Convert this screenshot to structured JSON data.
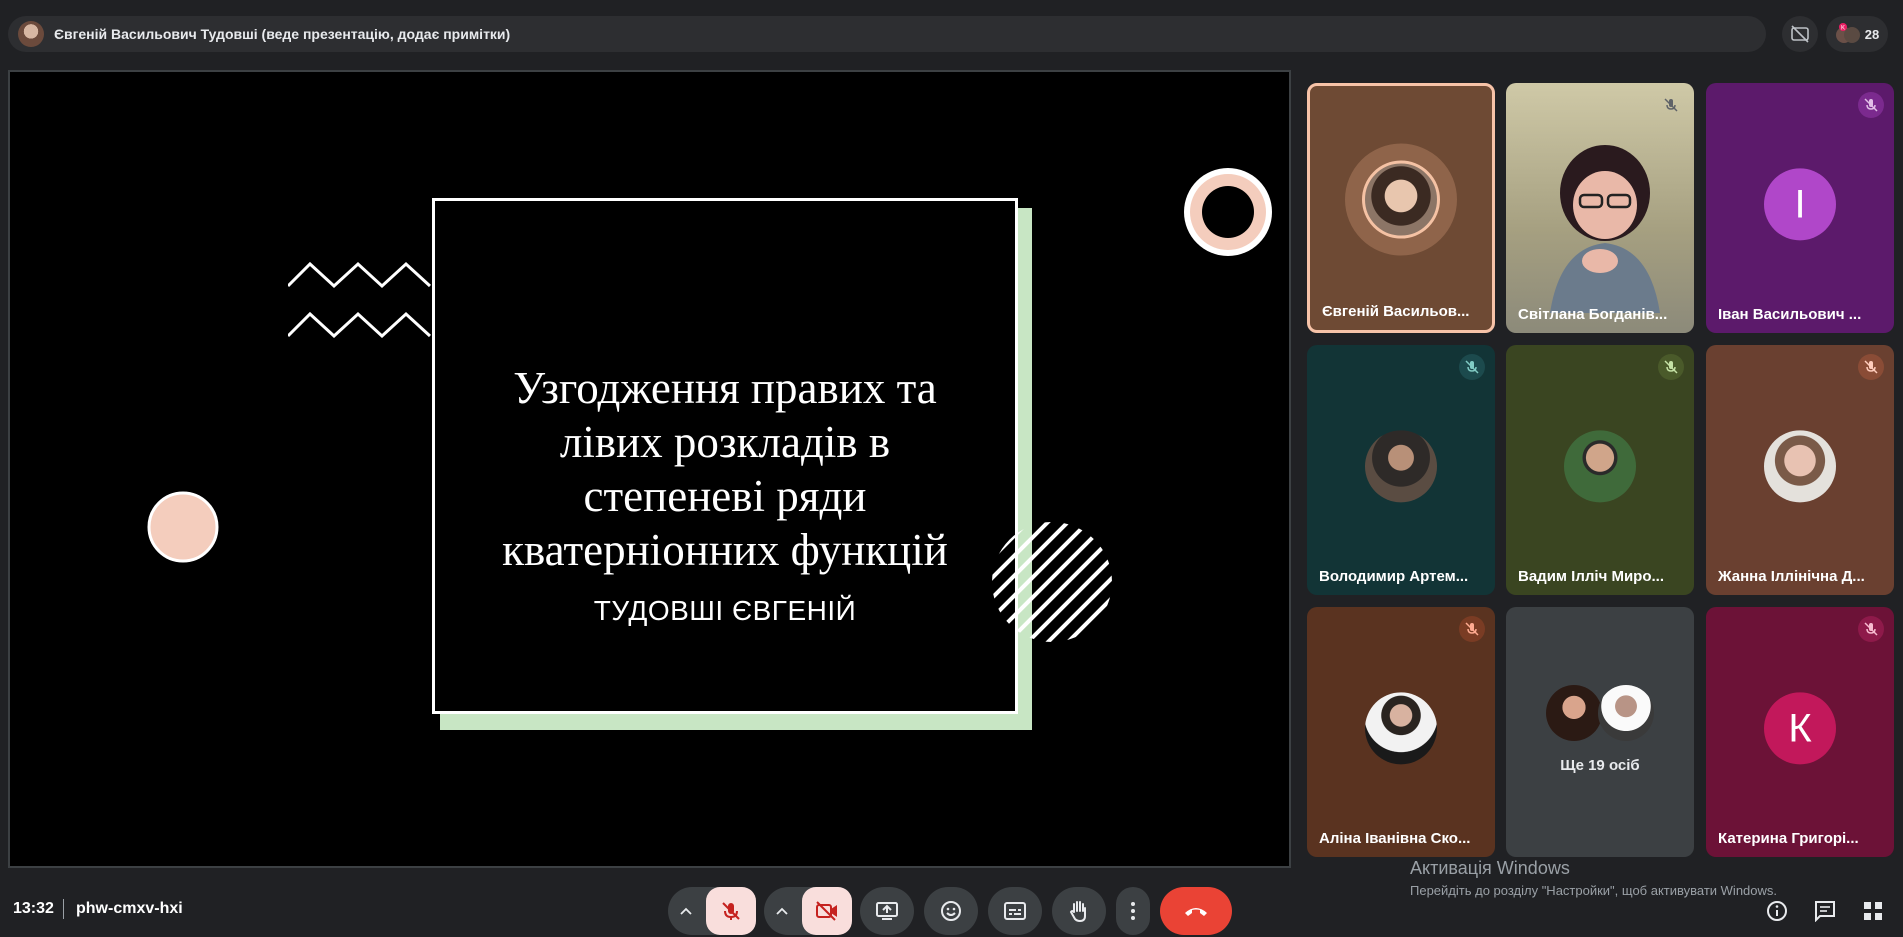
{
  "top_bar": {
    "presenter_text": "Євгеній Васильович Тудовші (веде презентацію, додає примітки)",
    "participants_count": "28",
    "icons": [
      "no-captions-icon",
      "participants-icon"
    ]
  },
  "slide": {
    "title_lines": [
      "Узгодження правих та",
      "лівих розкладів в",
      "степеневі ряди",
      "кватерніонних функцій"
    ],
    "author": "ТУДОВШІ ЄВГЕНІЙ"
  },
  "participants": [
    {
      "name": "Євгеній Васильов...",
      "kind": "photo",
      "bg": "#6e4a34",
      "speaking": true,
      "muted": false
    },
    {
      "name": "Світлана Богданів...",
      "kind": "video",
      "bg": "#b3ad88",
      "speaking": false,
      "muted": true
    },
    {
      "name": "Іван Васильович ...",
      "kind": "letter",
      "letter": "І",
      "bg": "#5c1a6b",
      "accent": "#b047c9",
      "muted": true
    },
    {
      "name": "Володимир Артем...",
      "kind": "photo",
      "bg": "#123436",
      "muted": true
    },
    {
      "name": "Вадим Ілліч Миро...",
      "kind": "photo",
      "bg": "#3a4521",
      "muted": true
    },
    {
      "name": "Жанна Іллінічна Д...",
      "kind": "photo",
      "bg": "#6a4030",
      "muted": true
    },
    {
      "name": "Аліна Іванівна Ско...",
      "kind": "photo",
      "bg": "#5a3320",
      "muted": true
    },
    {
      "name": "Ще 19 осіб",
      "kind": "more",
      "bg": "#3c4043"
    },
    {
      "name": "Катерина Григорі...",
      "kind": "letter",
      "letter": "К",
      "bg": "#6c1237",
      "accent": "#c2185b",
      "muted": true
    }
  ],
  "bottom_bar": {
    "time": "13:32",
    "meeting_code": "phw-cmxv-hxi",
    "controls": [
      "audio-options",
      "microphone-off",
      "video-options",
      "camera-off",
      "present-screen",
      "reactions",
      "captions",
      "raise-hand",
      "more-options",
      "leave-call"
    ]
  },
  "windows_watermark": {
    "title": "Активація Windows",
    "subtitle": "Перейдіть до розділу \"Настройки\", щоб активувати Windows."
  },
  "colors": {
    "background": "#202124",
    "end_call": "#ea4335",
    "muted_button": "#f9dedc",
    "slide_shadow": "#c8e6c4",
    "peach": "#f4cdbd"
  }
}
